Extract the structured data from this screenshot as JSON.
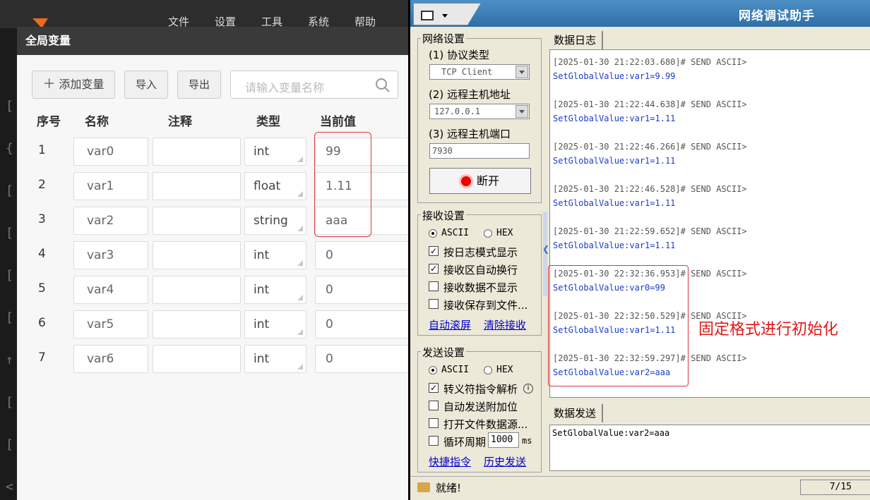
{
  "left_app": {
    "menu": [
      "文件",
      "设置",
      "工具",
      "系统",
      "帮助"
    ],
    "dialog_title": "全局变量",
    "toolbar": {
      "add_label": "添加变量",
      "import_label": "导入",
      "export_label": "导出",
      "search_placeholder": "请输入变量名称"
    },
    "columns": [
      "序号",
      "名称",
      "注释",
      "类型",
      "当前值"
    ],
    "rows": [
      {
        "idx": "1",
        "name": "var0",
        "comment": "",
        "type": "int",
        "value": "99"
      },
      {
        "idx": "2",
        "name": "var1",
        "comment": "",
        "type": "float",
        "value": "1.11"
      },
      {
        "idx": "3",
        "name": "var2",
        "comment": "",
        "type": "string",
        "value": "aaa"
      },
      {
        "idx": "4",
        "name": "var3",
        "comment": "",
        "type": "int",
        "value": "0"
      },
      {
        "idx": "5",
        "name": "var4",
        "comment": "",
        "type": "int",
        "value": "0"
      },
      {
        "idx": "6",
        "name": "var5",
        "comment": "",
        "type": "int",
        "value": "0"
      },
      {
        "idx": "7",
        "name": "var6",
        "comment": "",
        "type": "int",
        "value": "0"
      }
    ]
  },
  "net_app": {
    "title": "网络调试助手",
    "net_settings": {
      "group_title": "网络设置",
      "protocol_label": "(1) 协议类型",
      "protocol_value": "TCP Client",
      "host_label": "(2) 远程主机地址",
      "host_value": "127.0.0.1",
      "port_label": "(3) 远程主机端口",
      "port_value": "7930",
      "disconnect_label": "断开"
    },
    "recv_settings": {
      "group_title": "接收设置",
      "ascii_label": "ASCII",
      "hex_label": "HEX",
      "opt_log_mode": "按日志模式显示",
      "opt_auto_wrap": "接收区自动换行",
      "opt_hide_data": "接收数据不显示",
      "opt_save_file": "接收保存到文件...",
      "link_auto_scroll": "自动滚屏",
      "link_clear": "清除接收"
    },
    "send_settings": {
      "group_title": "发送设置",
      "ascii_label": "ASCII",
      "hex_label": "HEX",
      "opt_escape": "转义符指令解析",
      "opt_append_check": "自动发送附加位",
      "opt_open_file": "打开文件数据源...",
      "opt_loop": "循环周期",
      "loop_value": "1000",
      "loop_unit": "ms",
      "link_shortcut": "快捷指令",
      "link_history": "历史发送"
    },
    "log_tab": "数据日志",
    "log_entries": [
      {
        "head": "[2025-01-30 21:22:03.680]# SEND ASCII>",
        "body": "SetGlobalValue:var1=9.99"
      },
      {
        "head": "[2025-01-30 21:22:44.638]# SEND ASCII>",
        "body": "SetGlobalValue:var1=1.11"
      },
      {
        "head": "[2025-01-30 21:22:46.266]# SEND ASCII>",
        "body": "SetGlobalValue:var1=1.11"
      },
      {
        "head": "[2025-01-30 21:22:46.528]# SEND ASCII>",
        "body": "SetGlobalValue:var1=1.11"
      },
      {
        "head": "[2025-01-30 21:22:59.652]# SEND ASCII>",
        "body": "SetGlobalValue:var1=1.11"
      },
      {
        "head": "[2025-01-30 22:32:36.953]# SEND ASCII>",
        "body": "SetGlobalValue:var0=99"
      },
      {
        "head": "[2025-01-30 22:32:50.529]# SEND ASCII>",
        "body": "SetGlobalValue:var1=1.11"
      },
      {
        "head": "[2025-01-30 22:32:59.297]# SEND ASCII>",
        "body": "SetGlobalValue:var2=aaa"
      }
    ],
    "annotation": "固定格式进行初始化",
    "send_tab": "数据发送",
    "send_text": "SetGlobalValue:var2=aaa",
    "status_text": "就绪!",
    "status_count": "7/15"
  },
  "colors": {
    "highlight_red": "#d9363e",
    "annotation_red": "#e01818",
    "log_blue": "#1e3cc8"
  }
}
